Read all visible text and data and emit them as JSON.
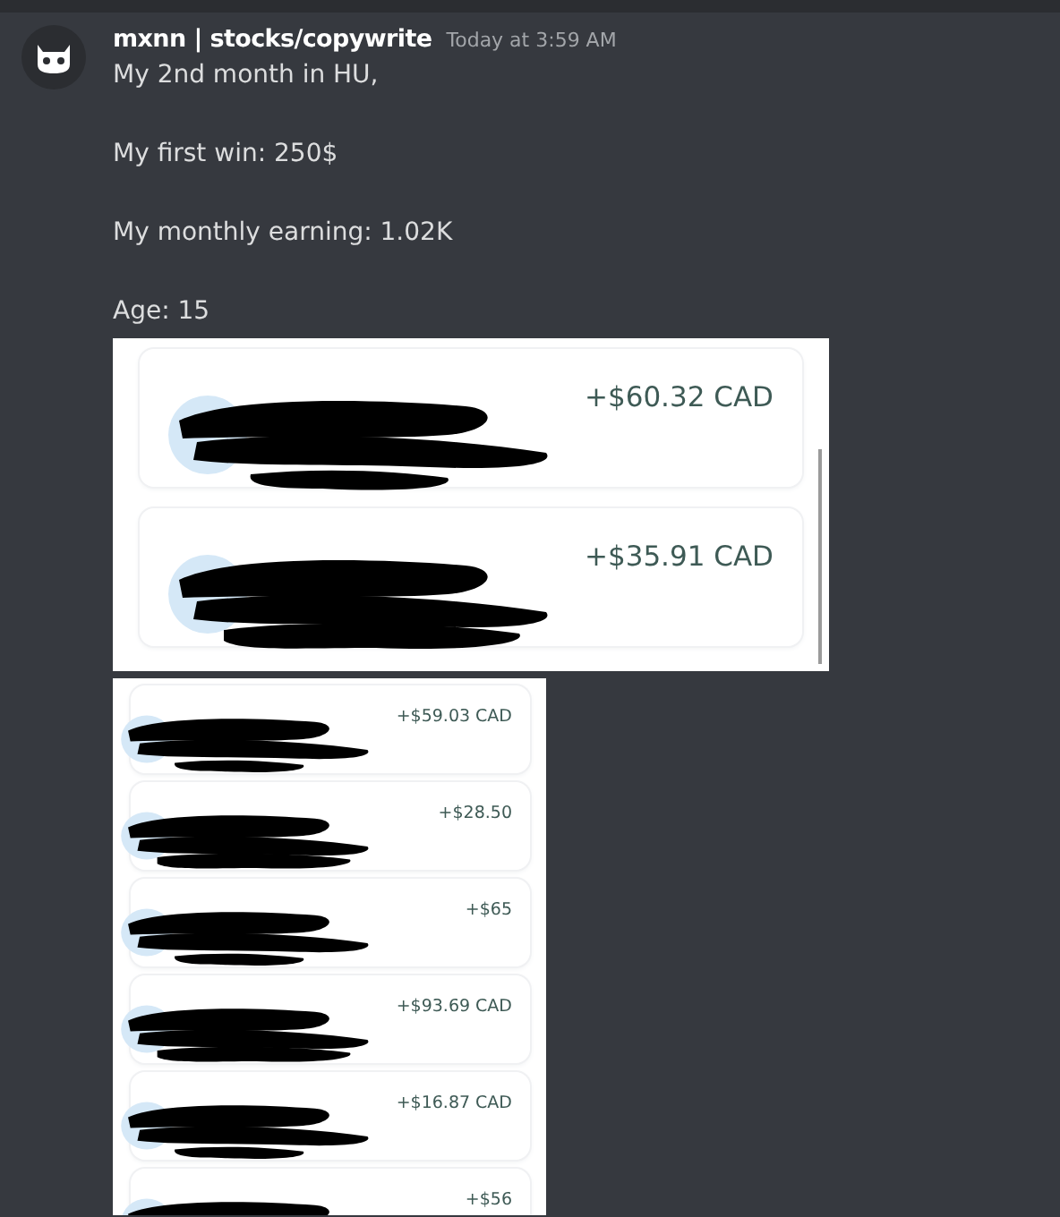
{
  "message": {
    "author": "mxnn | stocks/copywrite",
    "timestamp": "Today at 3:59 AM",
    "lines": [
      "My 2nd month in HU,",
      "My first win: 250$",
      "My monthly earning: 1.02K",
      "Age: 15"
    ]
  },
  "attachments": [
    {
      "kind": "large",
      "transactions": [
        {
          "amount": "+$60.32 CAD"
        },
        {
          "amount": "+$35.91 CAD"
        }
      ]
    },
    {
      "kind": "small",
      "transactions": [
        {
          "amount": "+$59.03 CAD"
        },
        {
          "amount": "+$28.50"
        },
        {
          "amount": "+$65"
        },
        {
          "amount": "+$93.69 CAD"
        },
        {
          "amount": "+$16.87 CAD"
        },
        {
          "amount": "+$56"
        }
      ]
    }
  ]
}
